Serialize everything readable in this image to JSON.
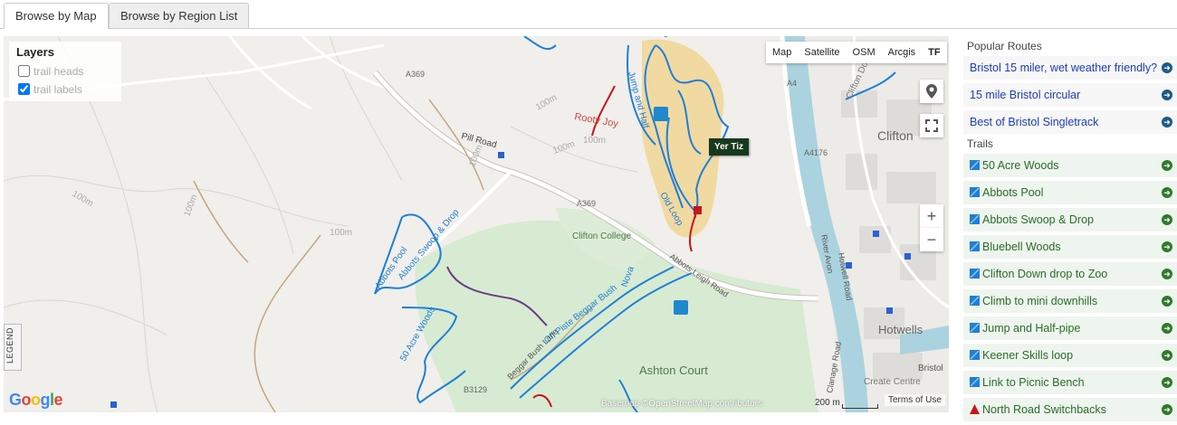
{
  "tabs": [
    {
      "label": "Browse by Map",
      "active": true
    },
    {
      "label": "Browse by Region List",
      "active": false
    }
  ],
  "map": {
    "layers": {
      "title": "Layers",
      "options": [
        {
          "label": "trail heads",
          "checked": false
        },
        {
          "label": "trail labels",
          "checked": true
        }
      ]
    },
    "map_types": [
      "Map",
      "Satellite",
      "OSM",
      "Arcgis",
      "TF"
    ],
    "legend_label": "LEGEND",
    "logo": "Google",
    "attribution": "Basemap ©OpenStreetMap contributors",
    "scale_label": "200 m",
    "terms": "Terms of Use",
    "zoom_in": "+",
    "zoom_out": "−",
    "tooltip": "Yer Tiz",
    "place_labels": {
      "clifton": "Clifton",
      "clifton_college": "Clifton College",
      "hotwells": "Hotwells",
      "ashton_court": "Ashton Court",
      "create_centre": "Create Centre",
      "bristol": "Bristol",
      "clifton_down": "Clifton Down",
      "pill_road": "Pill Road",
      "a369_top": "A369",
      "a369_mid": "A369",
      "a4": "A4",
      "a4176": "A4176",
      "b3129": "B3129",
      "rooty_joy": "Rooty Joy",
      "old_loop": "Old Loop",
      "nova": "Nova",
      "jump_half": "Jump and Half",
      "abbots_swoop": "Abbots Swoop & Drop",
      "abbots_pool": "Abbots Pool",
      "acre_woods": "50 Acre Woods",
      "off_piste": "Off Piste Beggar Bush",
      "beggar_bush": "Beggar Bush Lane",
      "abbots_leigh": "Abbots Leigh Road",
      "river": "River Avon",
      "hotwell_road": "Hotwell Road",
      "clanage_road": "Clanage Road",
      "contour_100m_1": "100m",
      "contour_100m_2": "100m",
      "contour_100m_3": "100m",
      "contour_100m_4": "100m",
      "contour_100m_5": "100m",
      "contour_100m_6": "100m",
      "contour_100m_7": "100m"
    }
  },
  "sidebar": {
    "popular_title": "Popular Routes",
    "routes": [
      "Bristol 15 miler, wet weather friendly?",
      "15 mile Bristol circular",
      "Best of Bristol Singletrack"
    ],
    "trails_title": "Trails",
    "trails": [
      {
        "label": "50 Acre Woods",
        "icon": "blue-square-trail-icon"
      },
      {
        "label": "Abbots Pool",
        "icon": "blue-square-trail-icon"
      },
      {
        "label": "Abbots Swoop & Drop",
        "icon": "blue-square-trail-icon"
      },
      {
        "label": "Bluebell Woods",
        "icon": "blue-square-trail-icon"
      },
      {
        "label": "Clifton Down drop to Zoo",
        "icon": "blue-square-trail-icon"
      },
      {
        "label": "Climb to mini downhills",
        "icon": "blue-square-trail-icon"
      },
      {
        "label": "Jump and Half-pipe",
        "icon": "blue-square-trail-icon"
      },
      {
        "label": "Keener Skills loop",
        "icon": "blue-square-trail-icon"
      },
      {
        "label": "Link to Picnic Bench",
        "icon": "blue-square-trail-icon"
      },
      {
        "label": "North Road Switchbacks",
        "icon": "red-triangle-trail-icon"
      }
    ]
  },
  "colors": {
    "trail_blue": "#1f7fd6",
    "trail_red": "#c8141e",
    "trail_purple": "#6b3d86",
    "park_green": "#d7ebd2",
    "highlight": "#f1d590",
    "route_link": "#1a3cc9",
    "trail_link": "#2a6d28"
  }
}
